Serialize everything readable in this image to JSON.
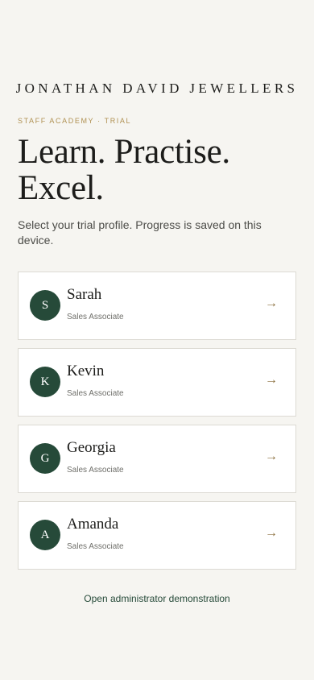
{
  "brand": {
    "name": "JONATHAN DAVID JEWELLERS"
  },
  "eyebrow": "STAFF ACADEMY · TRIAL",
  "headline": {
    "line1": "Learn. Practise.",
    "line2": "Excel."
  },
  "subtitle": "Select your trial profile. Progress is saved on this device.",
  "profiles": [
    {
      "initial": "S",
      "name": "Sarah",
      "role": "Sales Associate",
      "arrow": "→"
    },
    {
      "initial": "K",
      "name": "Kevin",
      "role": "Sales Associate",
      "arrow": "→"
    },
    {
      "initial": "G",
      "name": "Georgia",
      "role": "Sales Associate",
      "arrow": "→"
    },
    {
      "initial": "A",
      "name": "Amanda",
      "role": "Sales Associate",
      "arrow": "→"
    }
  ],
  "admin_link": "Open administrator demonstration",
  "colors": {
    "background": "#f6f5f1",
    "accent_gold": "#b09152",
    "avatar_green": "#264a39",
    "text_dark": "#1d1d1b"
  },
  "icons": {
    "card_arrow": "arrow-right-icon"
  }
}
